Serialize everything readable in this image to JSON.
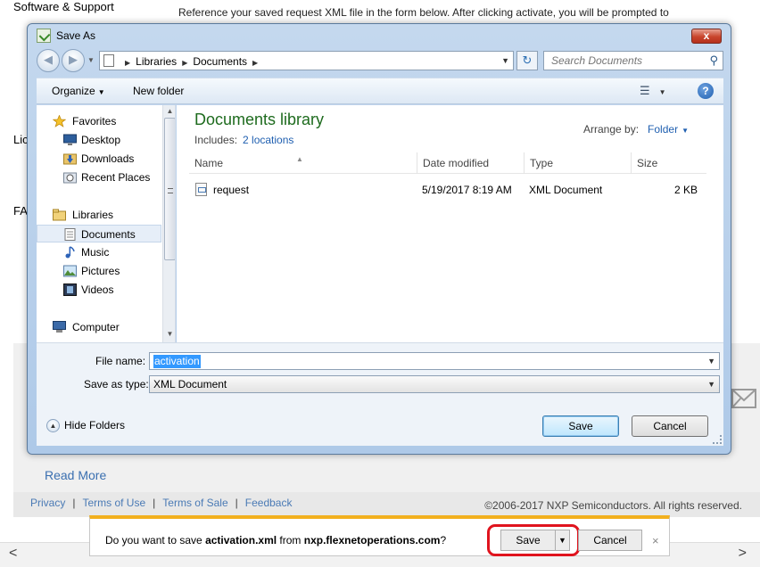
{
  "background": {
    "title": "Software & Support",
    "reference_text": "Reference your saved request XML file in the form below. After clicking activate, you will be prompted to",
    "left_fragment_1": "Lic",
    "left_fragment_2": "FA",
    "read_more": "Read More",
    "footer_links": [
      "Privacy",
      "Terms of Use",
      "Terms of Sale",
      "Feedback"
    ],
    "footer_sep": "|",
    "copyright": "©2006-2017 NXP Semiconductors. All rights reserved."
  },
  "dialog": {
    "title": "Save As",
    "close": "x",
    "breadcrumbs": [
      "Libraries",
      "Documents"
    ],
    "search_placeholder": "Search Documents",
    "toolbar": {
      "organize": "Organize",
      "new_folder": "New folder"
    },
    "nav": {
      "favorites": "Favorites",
      "desktop": "Desktop",
      "downloads": "Downloads",
      "recent_places": "Recent Places",
      "libraries": "Libraries",
      "documents": "Documents",
      "music": "Music",
      "pictures": "Pictures",
      "videos": "Videos",
      "computer": "Computer"
    },
    "library": {
      "title": "Documents library",
      "includes_label": "Includes:",
      "locations_link": "2 locations",
      "arrange_label": "Arrange by:",
      "arrange_value": "Folder"
    },
    "columns": {
      "name": "Name",
      "date": "Date modified",
      "type": "Type",
      "size": "Size"
    },
    "files": [
      {
        "name": "request",
        "date": "5/19/2017 8:19 AM",
        "type": "XML Document",
        "size": "2 KB"
      }
    ],
    "file_name_label": "File name:",
    "file_name_value": "activation",
    "save_type_label": "Save as type:",
    "save_type_value": "XML Document",
    "hide_folders": "Hide Folders",
    "save_button": "Save",
    "cancel_button": "Cancel"
  },
  "notification": {
    "prefix": "Do you want to save ",
    "filename": "activation.xml",
    "middle": " from ",
    "host": "nxp.flexnetoperations.com",
    "suffix": "?",
    "save": "Save",
    "cancel": "Cancel",
    "close": "×"
  }
}
